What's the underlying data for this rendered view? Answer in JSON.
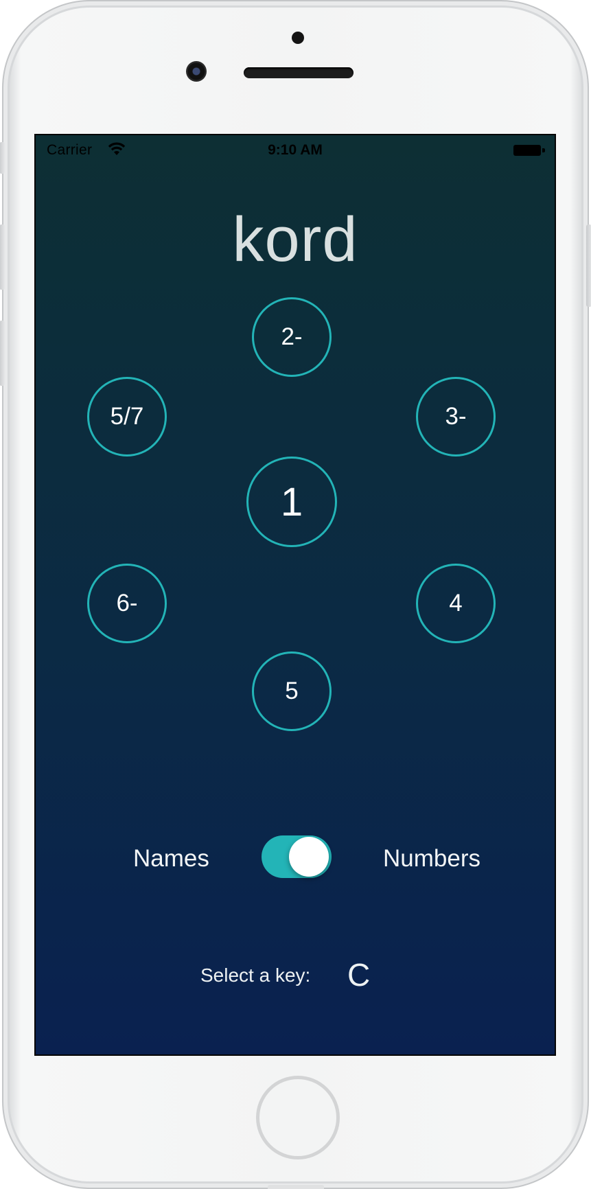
{
  "status_bar": {
    "carrier": "Carrier",
    "time": "9:10 AM",
    "wifi_icon": "wifi-icon",
    "battery_icon": "battery-icon"
  },
  "app": {
    "title": "kord"
  },
  "chord_wheel": {
    "accent_color": "#23b4b7",
    "top": "2-",
    "upper_left": "5/7",
    "upper_right": "3-",
    "center": "1",
    "lower_left": "6-",
    "lower_right": "4",
    "bottom": "5"
  },
  "display_toggle": {
    "left_label": "Names",
    "right_label": "Numbers",
    "is_on": true,
    "on_color": "#23b4b7"
  },
  "key_select": {
    "label": "Select a key:",
    "value": "C"
  },
  "colors": {
    "background_top": "#0d2f34",
    "background_bottom": "#0a2150"
  }
}
